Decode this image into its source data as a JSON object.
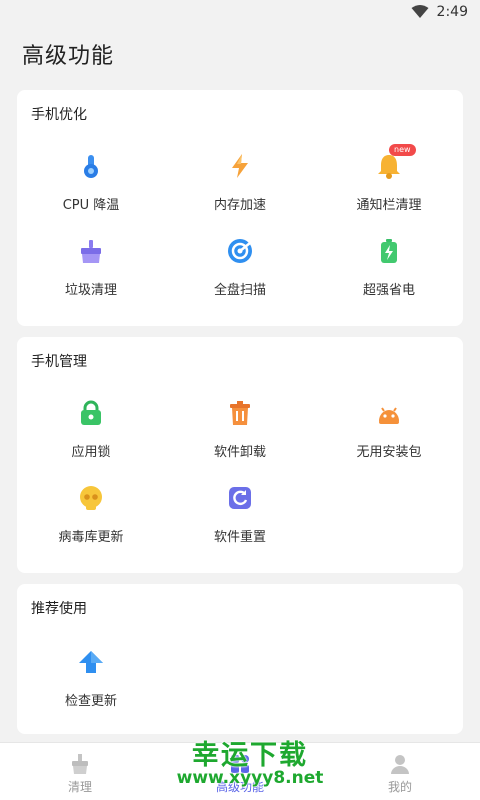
{
  "status_bar": {
    "time": "2:49",
    "icons": [
      "wifi-icon",
      "battery-icon"
    ]
  },
  "page": {
    "title": "高级功能"
  },
  "sections": [
    {
      "title": "手机优化",
      "items": [
        {
          "label": "CPU 降温",
          "icon": "thermometer-icon"
        },
        {
          "label": "内存加速",
          "icon": "lightning-icon"
        },
        {
          "label": "通知栏清理",
          "icon": "bell-icon",
          "badge": "new"
        },
        {
          "label": "垃圾清理",
          "icon": "broom-icon"
        },
        {
          "label": "全盘扫描",
          "icon": "scan-icon"
        },
        {
          "label": "超强省电",
          "icon": "battery-icon"
        }
      ]
    },
    {
      "title": "手机管理",
      "items": [
        {
          "label": "应用锁",
          "icon": "lock-icon"
        },
        {
          "label": "软件卸载",
          "icon": "trash-icon"
        },
        {
          "label": "无用安装包",
          "icon": "android-icon"
        },
        {
          "label": "病毒库更新",
          "icon": "skull-icon"
        },
        {
          "label": "软件重置",
          "icon": "reset-icon"
        }
      ]
    },
    {
      "title": "推荐使用",
      "items": [
        {
          "label": "检查更新",
          "icon": "update-arrow-icon"
        }
      ]
    }
  ],
  "tabbar": {
    "tabs": [
      {
        "label": "清理",
        "icon": "broom-tab-icon"
      },
      {
        "label": "高级功能",
        "icon": "grid-tab-icon",
        "active": true
      },
      {
        "label": "我的",
        "icon": "person-tab-icon"
      }
    ]
  },
  "watermark": {
    "line1": "幸运下载",
    "line2": "www.xyyy8.net"
  },
  "colors": {
    "accent": "#5a64e8",
    "background": "#f2f2f2",
    "card": "#ffffff"
  }
}
